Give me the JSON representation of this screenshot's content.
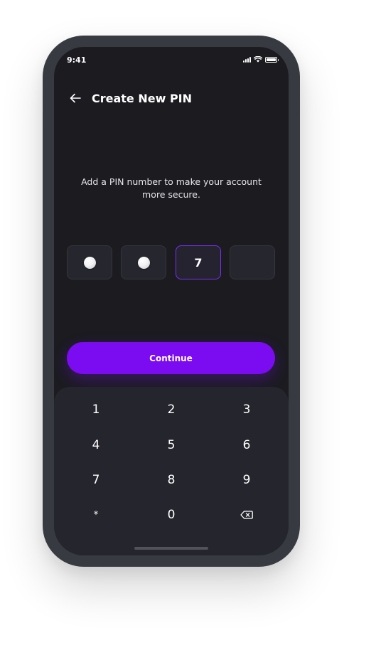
{
  "status_bar": {
    "time": "9:41"
  },
  "header": {
    "title": "Create New PIN",
    "back_icon": "arrow-left-icon"
  },
  "description": "Add a PIN number to make your account more secure.",
  "pin": {
    "length": 4,
    "entered_masked": 2,
    "current_digit": "7",
    "active_index": 2
  },
  "continue_button": {
    "label": "Continue"
  },
  "keypad": {
    "keys": [
      "1",
      "2",
      "3",
      "4",
      "5",
      "6",
      "7",
      "8",
      "9",
      "*",
      "0"
    ],
    "delete_icon": "backspace-icon"
  },
  "colors": {
    "accent": "#7b0cf2",
    "screen_bg": "#1b1b20",
    "keypad_bg": "#25262d",
    "phone_frame": "#383a42"
  }
}
